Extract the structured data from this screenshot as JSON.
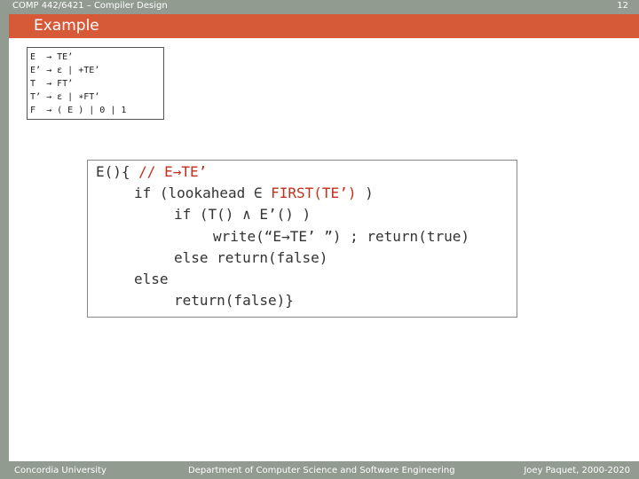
{
  "header": {
    "course": "COMP 442/6421 – Compiler Design",
    "slide_number": "12"
  },
  "title": "Example",
  "grammar": [
    {
      "lhs": "E ",
      "arrow": "→",
      "rhs": "TE’"
    },
    {
      "lhs": "E’",
      "arrow": "→",
      "rhs": "ε | +TE’"
    },
    {
      "lhs": "T ",
      "arrow": "→",
      "rhs": "FT’"
    },
    {
      "lhs": "T’",
      "arrow": "→",
      "rhs": "ε | ∗FT’"
    },
    {
      "lhs": "F ",
      "arrow": "→",
      "rhs": "( E ) | 0 | 1"
    }
  ],
  "code": {
    "line1_a": "E(){ ",
    "line1_comment": "// E→TE’",
    "line2_a": "if (lookahead ∈ ",
    "line2_first": "FIRST(TE’) ",
    "line2_b": ")",
    "line3": "if (T() ∧ E’() )",
    "line4": "write(“E→TE’ ”) ; return(true)",
    "line5": "else return(false)",
    "line6": "else",
    "line7": "return(false)}"
  },
  "footer": {
    "left": "Concordia University",
    "center": "Department of Computer Science and Software Engineering",
    "right": "Joey Paquet, 2000-2020"
  },
  "colors": {
    "title_bar": "#d65a38",
    "background": "#919b90",
    "code_highlight": "#c0301a"
  }
}
